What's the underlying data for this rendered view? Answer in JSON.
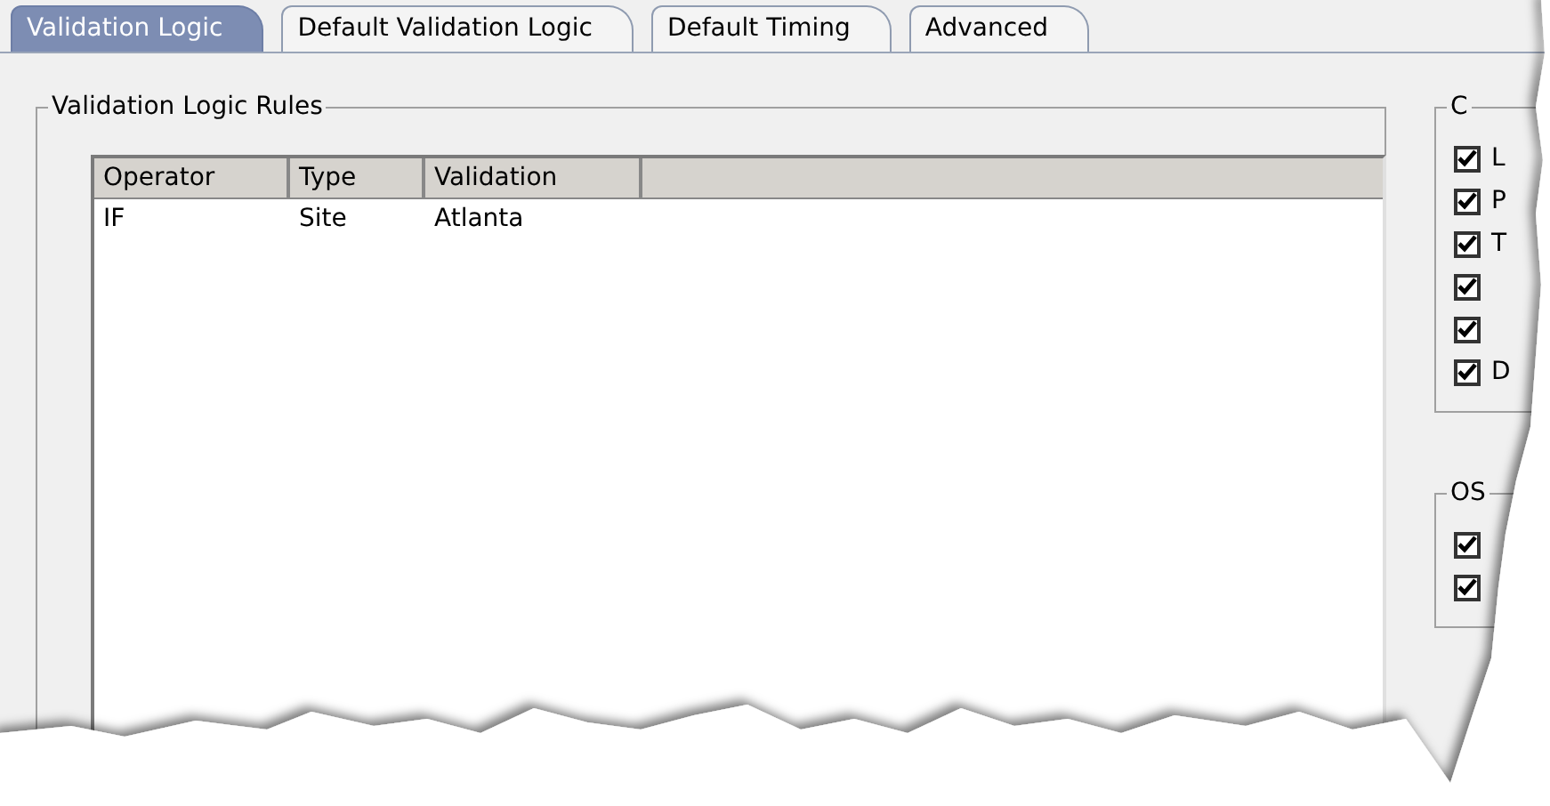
{
  "tabs": [
    {
      "label": "Validation Logic",
      "selected": true
    },
    {
      "label": "Default Validation Logic",
      "selected": false
    },
    {
      "label": "Default Timing",
      "selected": false
    },
    {
      "label": "Advanced",
      "selected": false
    }
  ],
  "rules_group": {
    "title": "Validation Logic Rules",
    "table": {
      "columns": [
        "Operator",
        "Type",
        "Validation"
      ],
      "rows": [
        [
          "IF",
          "Site",
          "Atlanta"
        ]
      ]
    }
  },
  "side_groups": [
    {
      "title": "C",
      "items": [
        {
          "label": "L",
          "checked": true
        },
        {
          "label": "P",
          "checked": true
        },
        {
          "label": "T",
          "checked": true
        },
        {
          "checked": true
        },
        {
          "checked": true
        },
        {
          "label": "D",
          "checked": true
        }
      ]
    },
    {
      "title": "OS",
      "items": [
        {
          "checked": true
        },
        {
          "checked": true
        }
      ]
    }
  ]
}
